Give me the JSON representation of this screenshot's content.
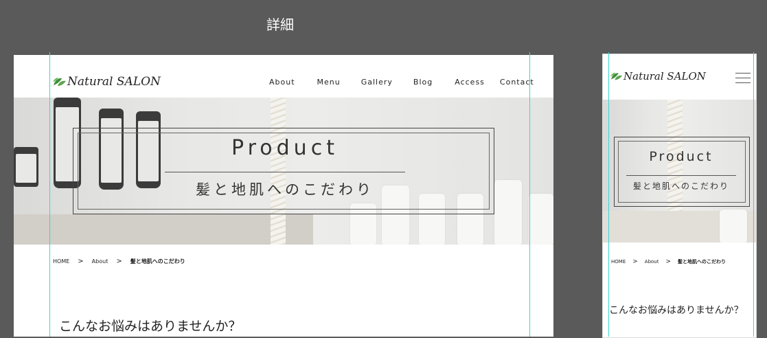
{
  "canvas": {
    "title": "詳細"
  },
  "colors": {
    "background": "#5a5a5a",
    "guide": "#39d5d5",
    "text": "#222222"
  },
  "pc": {
    "logo": {
      "text": "Natural SALON",
      "icon": "leaf-icon"
    },
    "nav": [
      "About",
      "Menu",
      "Gallery",
      "Blog",
      "Access",
      "Contact"
    ],
    "hero": {
      "title": "Product",
      "subtitle": "髪と地肌へのこだわり"
    },
    "breadcrumb": {
      "items": [
        "HOME",
        "About",
        "髪と地肌へのこだわり"
      ],
      "separator": ">"
    },
    "question": "こんなお悩みはありませんか？"
  },
  "sp": {
    "logo": {
      "text": "Natural SALON",
      "icon": "leaf-icon"
    },
    "menu_icon": "hamburger-menu-icon",
    "hero": {
      "title": "Product",
      "subtitle": "髪と地肌へのこだわり"
    },
    "breadcrumb": {
      "items": [
        "HOME",
        "About",
        "髪と地肌へのこだわり"
      ],
      "separator": ">"
    },
    "question": "こんなお悩みはありませんか？"
  }
}
